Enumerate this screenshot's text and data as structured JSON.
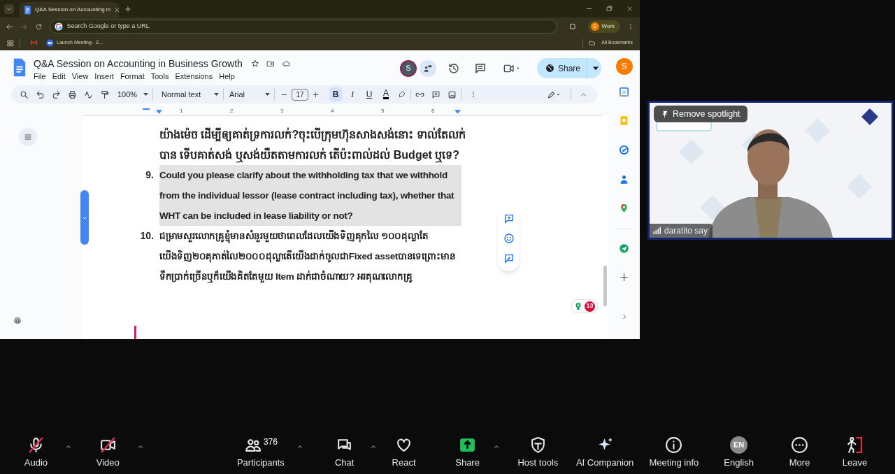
{
  "browser": {
    "tab_title": "Q&A Session on Accounting in",
    "address_placeholder": "Search Google or type a URL",
    "profile_initial": "S",
    "profile_label": "Work",
    "bookmarks": [
      "Launch Meeting - Z..."
    ],
    "all_bookmarks": "All Bookmarks"
  },
  "document": {
    "title": "Q&A Session on Accounting in Business Growth",
    "menu": [
      "File",
      "Edit",
      "View",
      "Insert",
      "Format",
      "Tools",
      "Extensions",
      "Help"
    ],
    "collaborator_initial": "S",
    "share": "Share",
    "account_initial": "S",
    "toolbar": {
      "zoom": "100%",
      "style": "Normal text",
      "font": "Arial",
      "font_size": "17",
      "format_buttons": [
        {
          "kind": "bold",
          "label": "B",
          "selected": true
        },
        {
          "kind": "italic",
          "label": "I",
          "selected": false
        },
        {
          "kind": "underline",
          "label": "U",
          "selected": false
        },
        {
          "kind": "color",
          "label": "A",
          "selected": false
        }
      ]
    },
    "ruler": [
      "1",
      "2",
      "3",
      "4",
      "5",
      "6"
    ],
    "paragraphs": [
      {
        "kind": "continuation",
        "text": "យ៉ាងម៉េច ដើម្បីឲ្យគាត់ទ្រការលក់?ចុះបើក្រុមហ៊ុនសាងសង់នោះ ទាល់តែលក់បាន ទើបគាត់សង់ ឬសង់យឺតតាមការលក់ តើប៉ះពាល់ដល់ Budget ឬទេ?",
        "highlighted": false
      },
      {
        "kind": "numbered",
        "number": "9.",
        "text": "Could you please clarify about the withholding tax that we withhold from the individual lessor (lease contract including tax), whether that WHT can be included in lease liability or not?",
        "highlighted": true
      },
      {
        "kind": "numbered",
        "number": "10.",
        "text": "ជម្រាមសួរលោកគ្រូខ្ញុំមានសំនួរមួយថាពេលដែលយើងទិញគុកលៃ ១០០ដុល្លាតែយើងទិញ២០គុភាត់លៃ២០០០ដុល្លាតើយើងដាក់ចូលជាFixed assetបានទេព្រោះមានទឹកប្រាក់ច្រើនឬក៏យើងគិតតែមួយ Item ដាក់ជាចំណាយ? អរគុណលោកគ្រូ",
        "highlighted": false
      }
    ],
    "badge_count": "13"
  },
  "video": {
    "spotlight": "Remove spotlight",
    "participant": "daratito say"
  },
  "meeting_toolbar": [
    {
      "kind": "audio",
      "label": "Audio",
      "off": true,
      "caret": true
    },
    {
      "kind": "video",
      "label": "Video",
      "off": true,
      "caret": true
    },
    {
      "kind": "participants",
      "label": "Participants",
      "count": "376",
      "off": false,
      "caret": true
    },
    {
      "kind": "chat",
      "label": "Chat",
      "off": false,
      "caret": true
    },
    {
      "kind": "react",
      "label": "React",
      "off": false,
      "caret": false
    },
    {
      "kind": "share",
      "label": "Share",
      "off": false,
      "caret": true
    },
    {
      "kind": "host",
      "label": "Host tools",
      "off": false,
      "caret": false
    },
    {
      "kind": "ai",
      "label": "AI Companion",
      "off": false,
      "caret": false
    },
    {
      "kind": "info",
      "label": "Meeting info",
      "off": false,
      "caret": false
    },
    {
      "kind": "language",
      "label": "English",
      "badge": "EN",
      "off": false,
      "caret": false
    },
    {
      "kind": "more",
      "label": "More",
      "off": false,
      "caret": false
    },
    {
      "kind": "leave",
      "label": "Leave",
      "off": false,
      "caret": false
    }
  ]
}
